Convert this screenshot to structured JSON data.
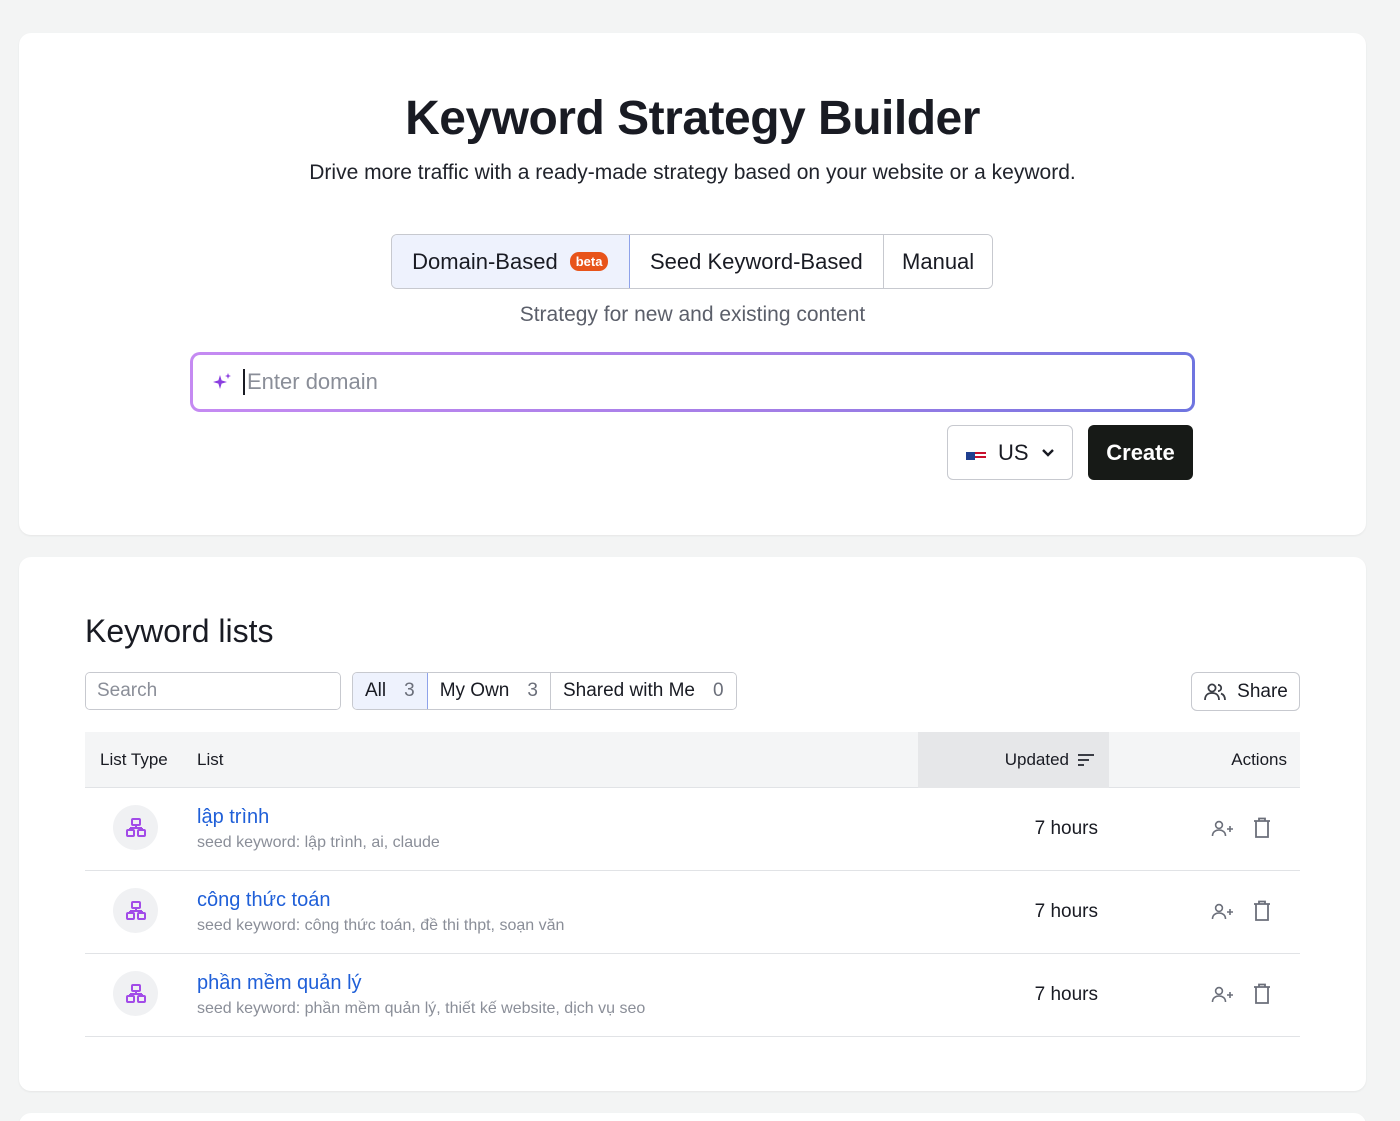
{
  "hero": {
    "title": "Keyword Strategy Builder",
    "subtitle": "Drive more traffic with a ready-made strategy based on your website or a keyword.",
    "tabs": [
      {
        "label": "Domain-Based",
        "badge": "beta",
        "active": true
      },
      {
        "label": "Seed Keyword-Based",
        "active": false
      },
      {
        "label": "Manual",
        "active": false
      }
    ],
    "mode_description": "Strategy for new and existing content",
    "domain_input": {
      "placeholder": "Enter domain",
      "value": ""
    },
    "country": "US",
    "create_label": "Create"
  },
  "lists": {
    "title": "Keyword lists",
    "search_placeholder": "Search",
    "filters": [
      {
        "label": "All",
        "count": "3",
        "active": true
      },
      {
        "label": "My Own",
        "count": "3",
        "active": false
      },
      {
        "label": "Shared with Me",
        "count": "0",
        "active": false
      }
    ],
    "share_label": "Share",
    "columns": {
      "type": "List Type",
      "list": "List",
      "updated": "Updated",
      "actions": "Actions"
    },
    "rows": [
      {
        "name": "lập trình",
        "seed": "seed keyword: lập trình, ai, claude",
        "updated": "7 hours"
      },
      {
        "name": "công thức toán",
        "seed": "seed keyword: công thức toán, đề thi thpt, soạn văn",
        "updated": "7 hours"
      },
      {
        "name": "phần mềm quản lý",
        "seed": "seed keyword: phần mềm quản lý, thiết kế website, dịch vụ seo",
        "updated": "7 hours"
      }
    ]
  },
  "colors": {
    "accent_blue": "#1f5fd8",
    "beta_badge": "#e8541a",
    "create_button": "#171a17",
    "list_type_icon": "#a24be8"
  },
  "icons": [
    "sparkle-icon",
    "us-flag-icon",
    "chevron-down-icon",
    "search-icon",
    "share-users-icon",
    "sort-icon",
    "keyword-list-icon",
    "add-user-icon",
    "trash-icon"
  ]
}
